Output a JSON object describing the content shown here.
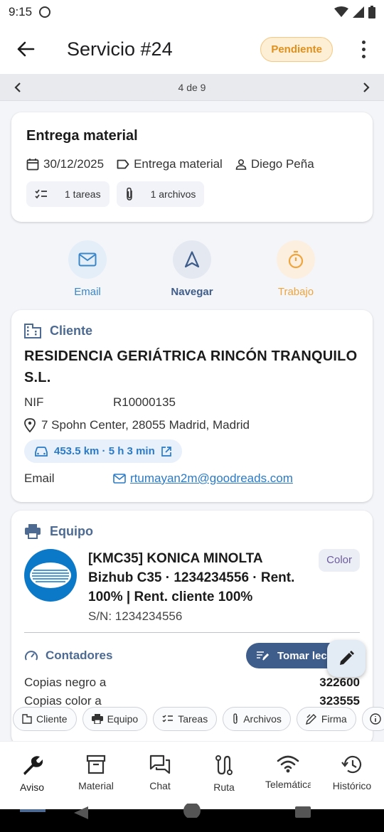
{
  "status_bar": {
    "time": "9:15"
  },
  "app_bar": {
    "title": "Servicio #24",
    "status_badge": "Pendiente"
  },
  "pager": {
    "position": "4 de 9"
  },
  "summary": {
    "title": "Entrega material",
    "date": "30/12/2025",
    "type": "Entrega material",
    "technician": "Diego Peña",
    "tasks_label": "1 tareas",
    "files_label": "1 archivos"
  },
  "actions": [
    {
      "label": "Email",
      "color": "#3a86c8",
      "bg": "#e4eef8",
      "icon": "mail-icon"
    },
    {
      "label": "Navegar",
      "color": "#3f5d8a",
      "bg": "#e4e9f1",
      "icon": "navigation-icon"
    },
    {
      "label": "Trabajo",
      "color": "#f0a43c",
      "bg": "#fcefe0",
      "icon": "timer-icon"
    }
  ],
  "client": {
    "section_title": "Cliente",
    "name": "RESIDENCIA GERIÁTRICA RINCÓN TRANQUILO S.L.",
    "nif_label": "NIF",
    "nif": "R10000135",
    "address": "7 Spohn Center, 28055 Madrid, Madrid",
    "distance": "453.5 km · 5 h 3 min",
    "email_label": "Email",
    "email": "rtumayan2m@goodreads.com"
  },
  "equipment": {
    "section_title": "Equipo",
    "model": "[KMC35] KONICA MINOLTA Bizhub C35 · 1234234556 · Rent. 100% | Rent. cliente 100%",
    "serial": "S/N: 1234234556",
    "color_tag": "Color",
    "counters_title": "Contadores",
    "reading_button": "Tomar lectura",
    "counters": [
      {
        "label": "Copias negro a",
        "value": "322600"
      },
      {
        "label": "Copias color a",
        "value": "323555"
      }
    ]
  },
  "quick_chips": [
    {
      "label": "Cliente",
      "icon": "building-icon"
    },
    {
      "label": "Equipo",
      "icon": "printer-icon"
    },
    {
      "label": "Tareas",
      "icon": "checklist-icon"
    },
    {
      "label": "Archivos",
      "icon": "paperclip-icon"
    },
    {
      "label": "Firma",
      "icon": "signature-icon"
    }
  ],
  "bottom_nav": [
    {
      "label": "Aviso",
      "icon": "wrench-icon"
    },
    {
      "label": "Material",
      "icon": "archive-icon"
    },
    {
      "label": "Chat",
      "icon": "chat-icon"
    },
    {
      "label": "Ruta",
      "icon": "route-icon"
    },
    {
      "label": "Telemática",
      "icon": "wifi-icon"
    },
    {
      "label": "Histórico",
      "icon": "history-icon"
    }
  ],
  "colors": {
    "accent": "#3f5d8a",
    "link": "#2a7ac8",
    "pending": "#e0901c"
  }
}
